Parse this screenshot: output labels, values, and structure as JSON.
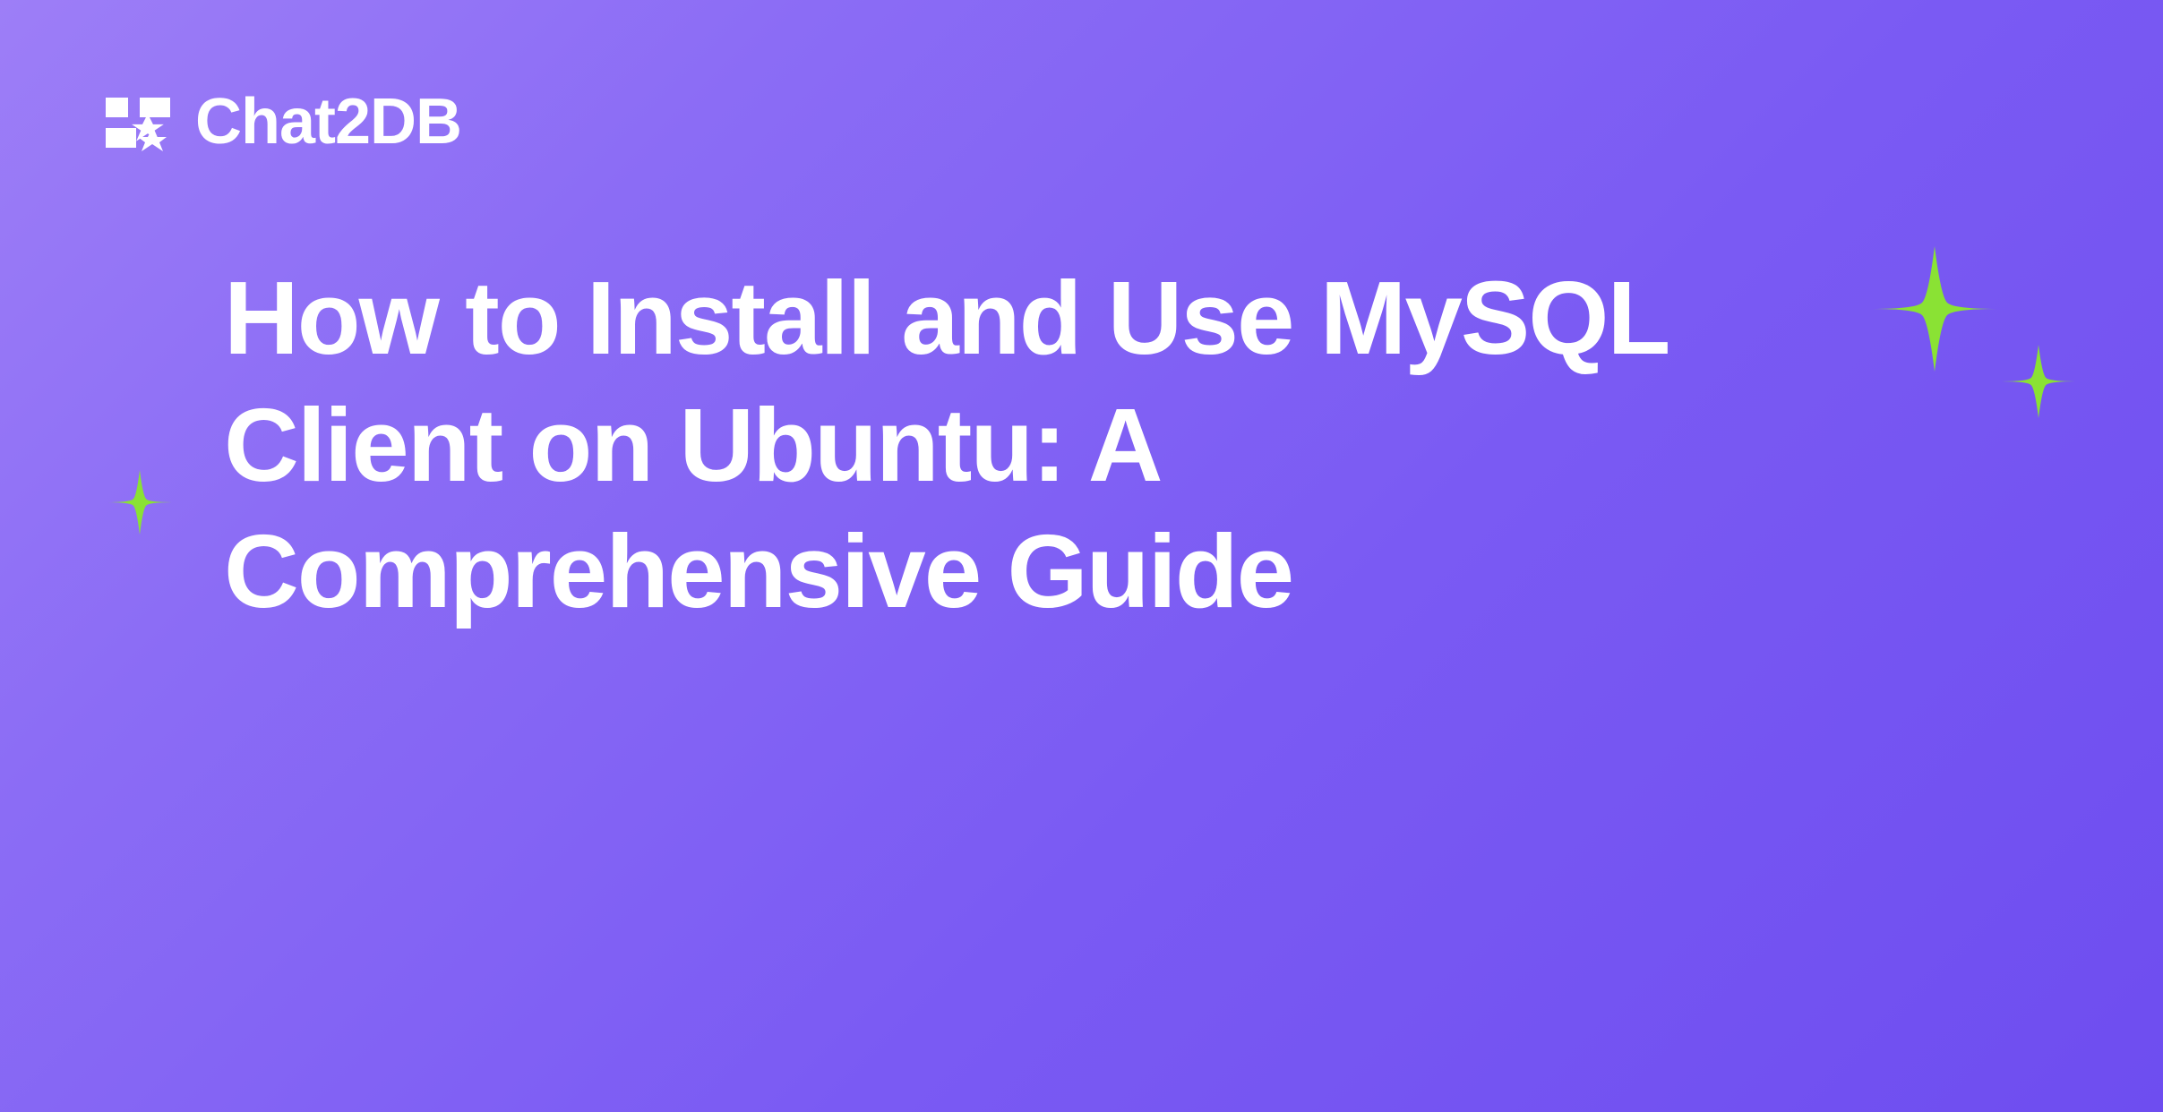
{
  "brand": {
    "name": "Chat2DB"
  },
  "title": "How to Install and Use MySQL Client on Ubuntu: A Comprehensive Guide"
}
